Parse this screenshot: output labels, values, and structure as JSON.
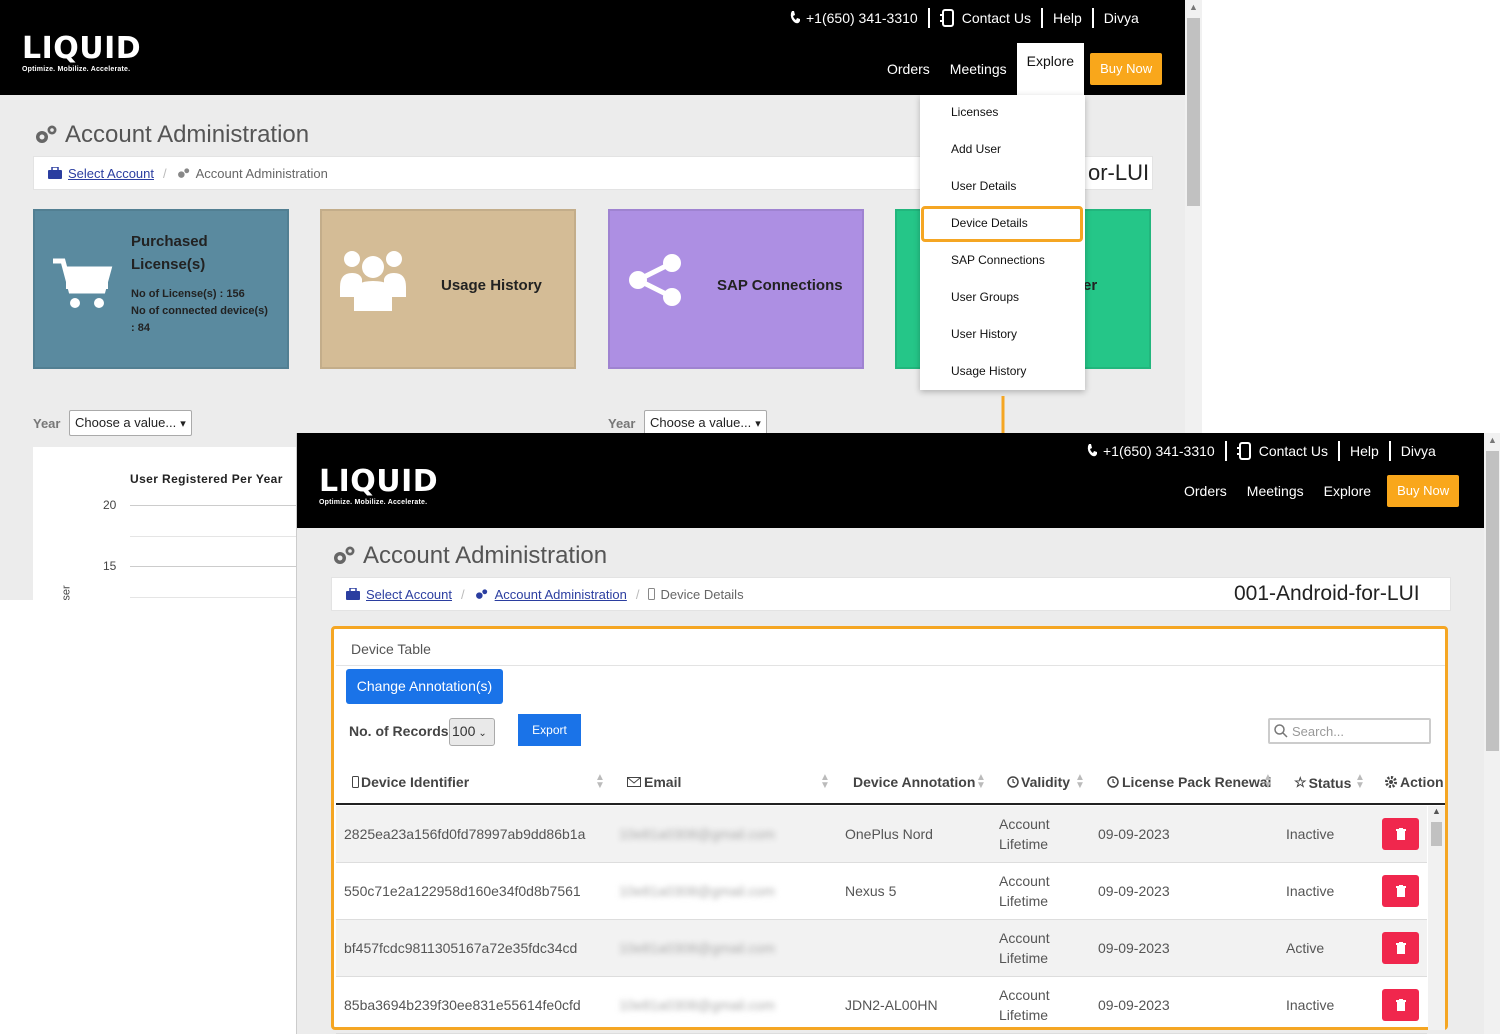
{
  "header": {
    "phone": "+1(650) 341-3310",
    "contact": "Contact Us",
    "help": "Help",
    "user": "Divya",
    "nav": [
      "Orders",
      "Meetings",
      "Explore"
    ],
    "buy_now": "Buy Now",
    "logo": "LIQUID",
    "tagline": "Optimize. Mobilize. Accelerate."
  },
  "background": {
    "title": "Account Administration",
    "breadcrumb": {
      "select_account": "Select Account",
      "current": "Account Administration"
    },
    "account_name_partial": "or-LUI",
    "tiles": {
      "purchased": {
        "title_line1": "Purchased",
        "title_line2": "License(s)",
        "licenses": "No of License(s) : 156",
        "devices_line1": "No of connected device(s)",
        "devices_line2": ": 84"
      },
      "usage": "Usage History",
      "sap": "SAP Connections",
      "user_partial": "er"
    },
    "year_label": "Year",
    "choose": "Choose a value...",
    "chart": {
      "title": "User Registered Per Year",
      "ticks": [
        "20",
        "15"
      ],
      "ylabel_partial": "ser"
    },
    "menu": [
      "Licenses",
      "Add User",
      "User Details",
      "Device Details",
      "SAP Connections",
      "User Groups",
      "User History",
      "Usage History"
    ]
  },
  "foreground": {
    "title": "Account Administration",
    "breadcrumb": {
      "select_account": "Select Account",
      "account_admin": "Account Administration",
      "current": "Device Details"
    },
    "account_name": "001-Android-for-LUI",
    "card_title": "Device Table",
    "change_btn": "Change Annotation(s)",
    "records_label": "No. of Records:",
    "records_value": "100",
    "export": "Export",
    "search_placeholder": "Search...",
    "columns": [
      "Device Identifier",
      "Email",
      "Device Annotation",
      "Validity",
      "License Pack Renewal",
      "Status",
      "Action"
    ],
    "rows": [
      {
        "id": "2825ea23a156fd0fd78997ab9dd86b1a",
        "email": "10e81a0308@gmail.com",
        "annotation": "OnePlus Nord",
        "validity1": "Account",
        "validity2": "Lifetime",
        "renewal": "09-09-2023",
        "status": "Inactive"
      },
      {
        "id": "550c71e2a122958d160e34f0d8b7561",
        "email": "10e81a0308@gmail.com",
        "annotation": "Nexus 5",
        "validity1": "Account",
        "validity2": "Lifetime",
        "renewal": "09-09-2023",
        "status": "Inactive"
      },
      {
        "id": "bf457fcdc9811305167a72e35fdc34cd",
        "email": "10e81a0308@gmail.com",
        "annotation": "",
        "validity1": "Account",
        "validity2": "Lifetime",
        "renewal": "09-09-2023",
        "status": "Active"
      },
      {
        "id": "85ba3694b239f30ee831e55614fe0cfd",
        "email": "10e81a0308@gmail.com",
        "annotation": "JDN2-AL00HN",
        "validity1": "Account",
        "validity2": "Lifetime",
        "renewal": "09-09-2023",
        "status": "Inactive"
      }
    ]
  },
  "colors": {
    "accent": "#f5a623",
    "buy": "#f9a71b",
    "primary": "#1a73e8",
    "danger": "#f0274d",
    "tile_blue": "#5a8a9f",
    "tile_tan": "#d4bc96",
    "tile_purple": "#ad8fe3",
    "tile_green": "#25c688"
  }
}
